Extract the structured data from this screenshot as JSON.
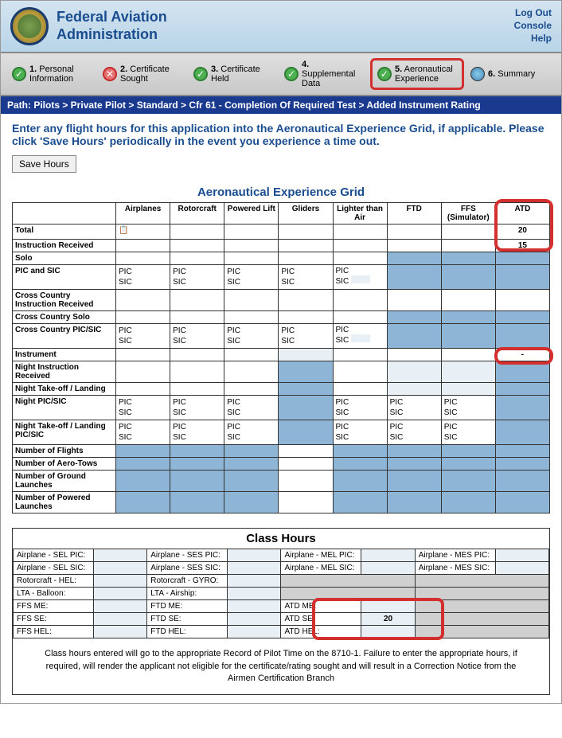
{
  "header": {
    "title_line1": "Federal Aviation",
    "title_line2": "Administration",
    "links": {
      "logout": "Log Out",
      "console": "Console",
      "help": "Help"
    }
  },
  "steps": [
    {
      "num": "1.",
      "label": "Personal Information",
      "icon": "check"
    },
    {
      "num": "2.",
      "label": "Certificate Sought",
      "icon": "x"
    },
    {
      "num": "3.",
      "label": "Certificate Held",
      "icon": "check"
    },
    {
      "num": "4.",
      "label": "Supplemental Data",
      "icon": "check"
    },
    {
      "num": "5.",
      "label": "Aeronautical Experience",
      "icon": "check",
      "highlight": true
    },
    {
      "num": "6.",
      "label": "Summary",
      "icon": "globe"
    }
  ],
  "path": "Path:  Pilots  >  Private Pilot  >  Standard  >  Cfr 61 - Completion Of Required Test  >  Added Instrument Rating",
  "instructions": "Enter any flight hours for this application into the Aeronautical Experience Grid, if applicable. Please click 'Save Hours' periodically in the event you experience a time out.",
  "save_btn": "Save Hours",
  "grid_title": "Aeronautical Experience Grid",
  "columns": [
    "Airplanes",
    "Rotorcraft",
    "Powered Lift",
    "Gliders",
    "Lighter than Air",
    "FTD",
    "FFS (Simulator)",
    "ATD"
  ],
  "rows": {
    "total": {
      "label": "Total",
      "atd": "20"
    },
    "instruction": {
      "label": "Instruction Received",
      "atd": "15"
    },
    "solo": {
      "label": "Solo"
    },
    "pic_sic": {
      "label": "PIC and SIC"
    },
    "cc_instruction": {
      "label": "Cross Country Instruction Received"
    },
    "cc_solo": {
      "label": "Cross Country Solo"
    },
    "cc_pic_sic": {
      "label": "Cross Country PIC/SIC"
    },
    "instrument": {
      "label": "Instrument",
      "atd": "-"
    },
    "night_instruction": {
      "label": "Night Instruction Received"
    },
    "night_tol": {
      "label": "Night Take-off / Landing"
    },
    "night_pic_sic": {
      "label": "Night PIC/SIC"
    },
    "night_tol_pic_sic": {
      "label": "Night Take-off / Landing PIC/SIC"
    },
    "num_flights": {
      "label": "Number of Flights"
    },
    "num_aerotows": {
      "label": "Number of Aero-Tows"
    },
    "num_ground": {
      "label": "Number of Ground Launches"
    },
    "num_powered": {
      "label": "Number of Powered Launches"
    }
  },
  "pic_sic_text": "PIC\nSIC",
  "class_title": "Class Hours",
  "class_rows": [
    [
      {
        "l": "Airplane - SEL PIC:"
      },
      {
        "l": "Airplane - SES PIC:"
      },
      {
        "l": "Airplane - MEL PIC:"
      },
      {
        "l": "Airplane - MES PIC:"
      }
    ],
    [
      {
        "l": "Airplane - SEL SIC:"
      },
      {
        "l": "Airplane - SES SIC:"
      },
      {
        "l": "Airplane - MEL SIC:"
      },
      {
        "l": "Airplane - MES SIC:"
      }
    ],
    [
      {
        "l": "Rotorcraft - HEL:"
      },
      {
        "l": "Rotorcraft - GYRO:"
      },
      {
        "l": "",
        "grey": true
      },
      {
        "l": "",
        "grey": true
      }
    ],
    [
      {
        "l": "LTA - Balloon:"
      },
      {
        "l": "LTA - Airship:"
      },
      {
        "l": "",
        "grey": true
      },
      {
        "l": "",
        "grey": true
      }
    ],
    [
      {
        "l": "FFS ME:"
      },
      {
        "l": "FTD ME:"
      },
      {
        "l": "ATD ME:"
      },
      {
        "l": "",
        "grey": true
      }
    ],
    [
      {
        "l": "FFS SE:"
      },
      {
        "l": "FTD SE:"
      },
      {
        "l": "ATD SE:",
        "v": "20"
      },
      {
        "l": "",
        "grey": true
      }
    ],
    [
      {
        "l": "FFS HEL:"
      },
      {
        "l": "FTD HEL:"
      },
      {
        "l": "ATD HEL:"
      },
      {
        "l": "",
        "grey": true
      }
    ]
  ],
  "class_note": "Class hours entered will go to the appropriate Record of Pilot Time on the 8710-1. Failure to enter the appropriate hours, if required, will render the applicant not eligible for the certificate/rating sought and will result in a Correction Notice from the Airmen Certification Branch"
}
